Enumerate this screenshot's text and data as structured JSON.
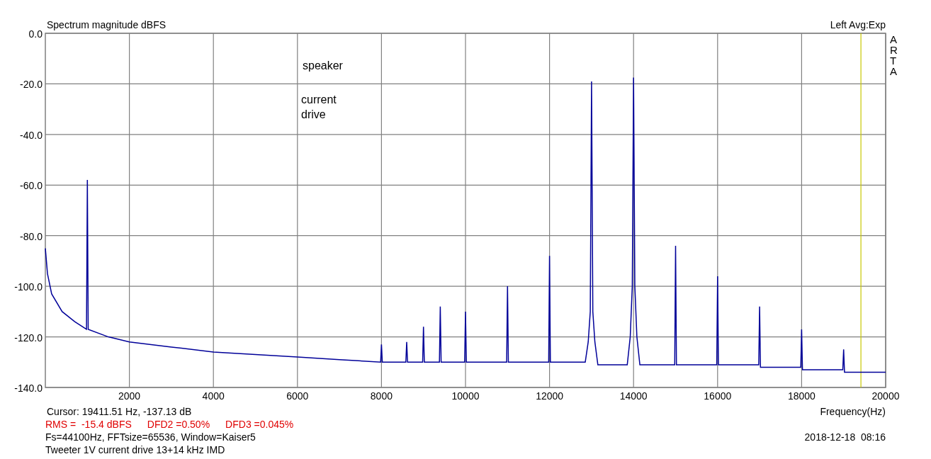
{
  "chart": {
    "channel_info": "Left  Avg:Exp",
    "brand": "ARTA",
    "chart_data": {
      "type": "line",
      "title": "Spectrum magnitude dBFS",
      "xlabel": "Frequency(Hz)",
      "xlim": [
        0,
        20000
      ],
      "ylim": [
        -140,
        0
      ],
      "xticks": [
        2000,
        4000,
        6000,
        8000,
        10000,
        12000,
        14000,
        16000,
        18000,
        20000
      ],
      "yticks": [
        {
          "value": 0,
          "label": "0.0"
        },
        {
          "value": -20,
          "label": "-20.0"
        },
        {
          "value": -40,
          "label": "-40.0"
        },
        {
          "value": -60,
          "label": "-60.0"
        },
        {
          "value": -80,
          "label": "-80.0"
        },
        {
          "value": -100,
          "label": "-100.0"
        },
        {
          "value": -120,
          "label": "-120.0"
        },
        {
          "value": -140,
          "label": "-140.0"
        }
      ],
      "x": [
        0,
        50,
        150,
        400,
        700,
        980,
        1000,
        1020,
        1500,
        2000,
        3000,
        4000,
        5000,
        6000,
        7000,
        7980,
        8000,
        8020,
        8580,
        8600,
        8620,
        8980,
        9000,
        9020,
        9380,
        9400,
        9420,
        9980,
        10000,
        10020,
        10980,
        11000,
        11020,
        11980,
        12000,
        12020,
        12850,
        12920,
        12970,
        13000,
        13030,
        13080,
        13150,
        13850,
        13920,
        13970,
        14000,
        14030,
        14080,
        14150,
        14980,
        15000,
        15020,
        15980,
        16000,
        16020,
        16980,
        17000,
        17020,
        17980,
        18000,
        18020,
        18980,
        19000,
        19020,
        20000
      ],
      "series": [
        {
          "color": "#000099",
          "values": [
            -85,
            -95,
            -103,
            -110,
            -114,
            -117,
            -58,
            -117,
            -120,
            -122,
            -124,
            -126,
            -127,
            -128,
            -129,
            -130,
            -123,
            -130,
            -130,
            -122,
            -130,
            -130,
            -116,
            -130,
            -130,
            -108,
            -130,
            -130,
            -110,
            -130,
            -130,
            -100,
            -130,
            -130,
            -88,
            -130,
            -130,
            -122,
            -110,
            -19,
            -110,
            -122,
            -131,
            -131,
            -120,
            -100,
            -17.5,
            -100,
            -120,
            -131,
            -131,
            -84,
            -131,
            -131,
            -96,
            -131,
            -131,
            -108,
            -132,
            -132,
            -117,
            -133,
            -133,
            -125,
            -134,
            -134
          ]
        }
      ],
      "grid": true,
      "ref_lines": [
        {
          "axis": "x",
          "value": 19411.51
        }
      ],
      "annotations": [
        "speaker",
        "current\ndrive"
      ]
    }
  },
  "footer": {
    "cursor": "Cursor: 19411.51 Hz, -137.13 dB",
    "measurements": [
      "RMS =  -15.4 dBFS",
      "DFD2 =0.50%",
      "DFD3 =0.045%"
    ],
    "settings": "Fs=44100Hz, FFTsize=65536, Window=Kaiser5",
    "description": "Tweeter 1V current drive 13+14 kHz IMD",
    "timestamp": "2018-12-18  08:16"
  }
}
